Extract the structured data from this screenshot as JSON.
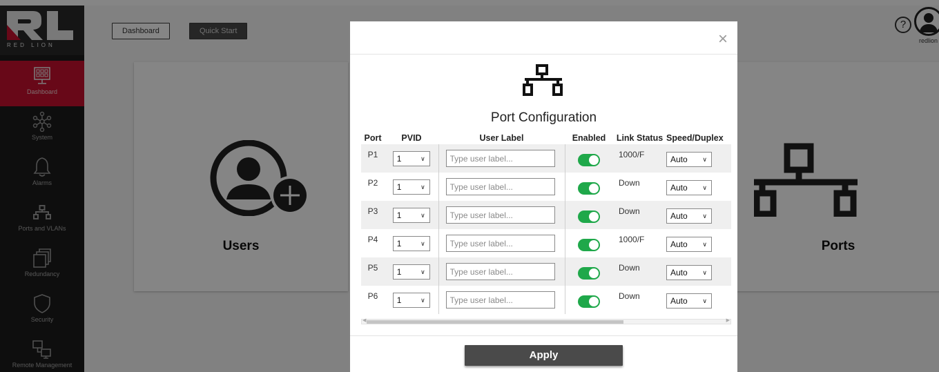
{
  "brand": {
    "wordmark": "RED LION"
  },
  "sidebar": {
    "items": [
      {
        "label": "Dashboard",
        "icon": "dashboard-icon",
        "active": true
      },
      {
        "label": "System",
        "icon": "network-nodes-icon"
      },
      {
        "label": "Alarms",
        "icon": "bell-icon"
      },
      {
        "label": "Ports and VLANs",
        "icon": "network-ports-icon"
      },
      {
        "label": "Redundancy",
        "icon": "stacked-windows-icon"
      },
      {
        "label": "Security",
        "icon": "shield-icon"
      },
      {
        "label": "Remote Management",
        "icon": "remote-screens-icon"
      }
    ]
  },
  "header": {
    "dashboard_button": "Dashboard",
    "quickstart_button": "Quick Start",
    "help_symbol": "?",
    "username": "redlion"
  },
  "cards": {
    "users": {
      "title": "Users"
    },
    "ports": {
      "title": "Ports"
    }
  },
  "modal": {
    "close_symbol": "×",
    "title": "Port Configuration",
    "columns": [
      "Port",
      "PVID",
      "User Label",
      "Enabled",
      "Link Status",
      "Speed/Duplex"
    ],
    "label_placeholder": "Type user label...",
    "rows": [
      {
        "port": "P1",
        "pvid": "1",
        "enabled": true,
        "link_status": "1000/F",
        "speed": "Auto"
      },
      {
        "port": "P2",
        "pvid": "1",
        "enabled": true,
        "link_status": "Down",
        "speed": "Auto"
      },
      {
        "port": "P3",
        "pvid": "1",
        "enabled": true,
        "link_status": "Down",
        "speed": "Auto"
      },
      {
        "port": "P4",
        "pvid": "1",
        "enabled": true,
        "link_status": "1000/F",
        "speed": "Auto"
      },
      {
        "port": "P5",
        "pvid": "1",
        "enabled": true,
        "link_status": "Down",
        "speed": "Auto"
      },
      {
        "port": "P6",
        "pvid": "1",
        "enabled": true,
        "link_status": "Down",
        "speed": "Auto"
      }
    ],
    "apply_button": "Apply"
  },
  "colors": {
    "accent_red": "#c8102e",
    "sidebar_bg": "#1b1b1b",
    "toggle_on": "#1fa84a",
    "button_dark": "#4a4a4a"
  }
}
